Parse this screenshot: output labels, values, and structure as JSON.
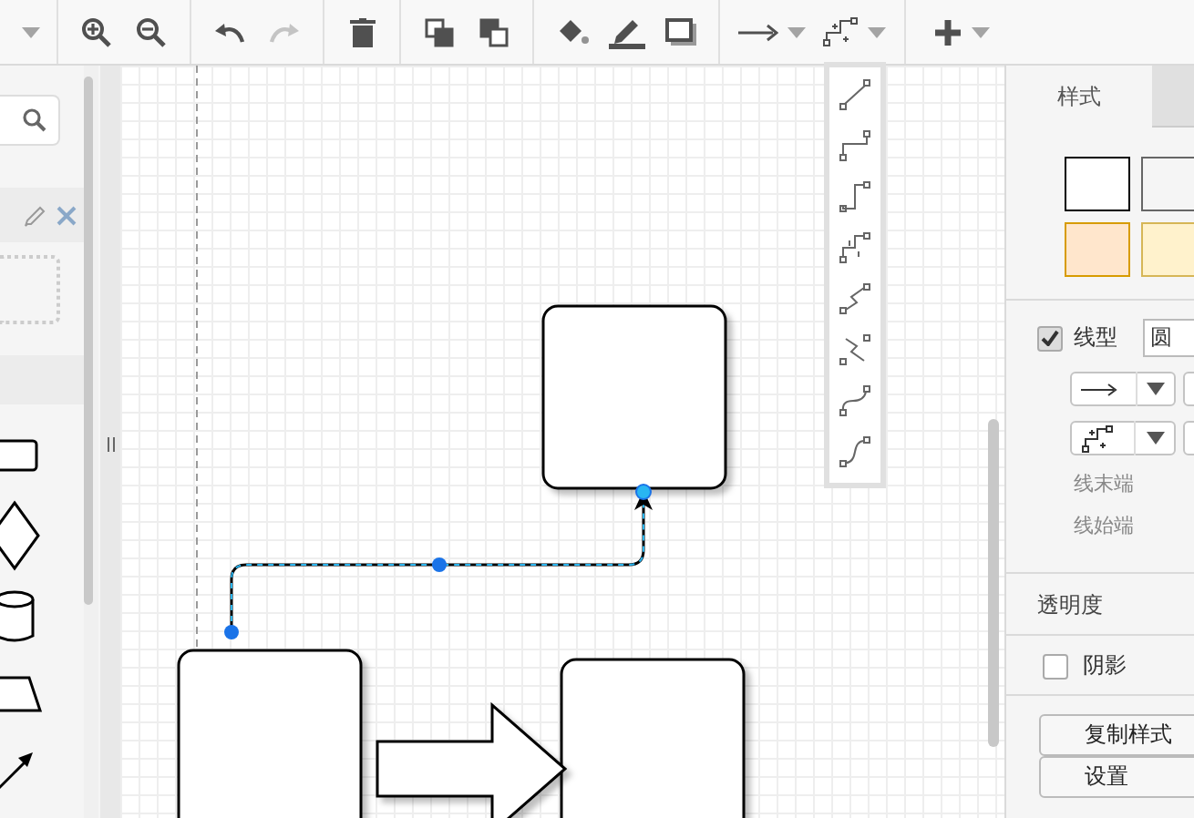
{
  "toolbar": {
    "groups": [
      [
        {
          "kind": "caret",
          "disabled": false
        }
      ],
      [
        {
          "kind": "zoom-in",
          "disabled": false
        },
        {
          "kind": "zoom-out",
          "disabled": false
        }
      ],
      [
        {
          "kind": "undo",
          "disabled": false
        },
        {
          "kind": "redo",
          "disabled": true
        }
      ],
      [
        {
          "kind": "delete",
          "disabled": false
        }
      ],
      [
        {
          "kind": "to-front",
          "disabled": false
        },
        {
          "kind": "to-back",
          "disabled": false
        }
      ],
      [
        {
          "kind": "fill",
          "disabled": false
        },
        {
          "kind": "line-color",
          "disabled": false
        },
        {
          "kind": "shadow",
          "disabled": false
        }
      ],
      [
        {
          "kind": "connection",
          "disabled": false
        },
        {
          "kind": "waypoints",
          "disabled": false
        }
      ],
      [
        {
          "kind": "insert",
          "disabled": false
        }
      ]
    ]
  },
  "format_panel": {
    "tabs": [
      {
        "label": "样式",
        "selected": true
      },
      {
        "selected": false
      }
    ],
    "swatches": [
      {
        "color": "#ffffff",
        "border": {
          "color": "#000000"
        }
      },
      {
        "color": "#f5f5f5",
        "border": {
          "color": "#666666"
        }
      },
      {
        "color": "#ffe6cc",
        "border": {
          "color": "#d79b00"
        }
      },
      {
        "color": "#fff2cc",
        "border": {
          "color": "#d6b656"
        }
      }
    ],
    "line": {
      "checked": true,
      "label": "线型",
      "pattern": "圆"
    },
    "end_labels": [
      "线末端",
      "线始端"
    ],
    "opacity_label": "透明度",
    "shadow": {
      "label": "阴影",
      "checked": false
    },
    "buttons": [
      "复制样式",
      "设置"
    ]
  }
}
